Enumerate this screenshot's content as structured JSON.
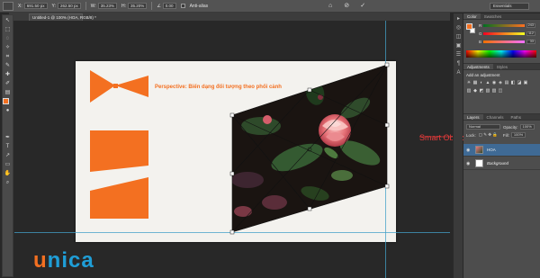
{
  "options_bar": {
    "x_label": "X:",
    "x_value": "691.50 px",
    "y_label": "Y:",
    "y_value": "262.50 px",
    "w_label": "W:",
    "w_value": "35.23%",
    "h_label": "H:",
    "h_value": "35.20%",
    "angle_value": "0.00",
    "antialias_label": "Anti-alias",
    "workspace_value": "Essentials"
  },
  "document": {
    "tab_title": "Untitled-1 @ 100% (HOA, RGB/8) *"
  },
  "canvas": {
    "headline": "Perspective: Biến dạng đối tượng theo phối cảnh",
    "accent_color": "#f37021"
  },
  "annotation": {
    "smart_object_label": "Smart Object"
  },
  "brand": {
    "part1": "u",
    "part2": "nica",
    "color_orange": "#f37021",
    "color_blue": "#1f9ed7"
  },
  "panels": {
    "color_tabs": [
      "Color",
      "Swatches"
    ],
    "rgb": [
      {
        "channel": "R",
        "value": "243"
      },
      {
        "channel": "G",
        "value": "112"
      },
      {
        "channel": "B",
        "value": "33"
      }
    ],
    "adjust_tabs": [
      "Adjustments",
      "Styles"
    ],
    "adjust_title": "Add an adjustment",
    "adjust_icons": [
      "☀",
      "▦",
      "◐",
      "▲",
      "◉",
      "◈",
      "▤",
      "◧",
      "◪",
      "▣",
      "▥",
      "◆",
      "◩",
      "▧",
      "▨",
      "◫"
    ],
    "layers_tabs": [
      "Layers",
      "Channels",
      "Paths"
    ],
    "blend_mode": "Normal",
    "opacity_label": "Opacity:",
    "opacity_value": "100%",
    "lock_label": "Lock:",
    "fill_label": "Fill:",
    "fill_value": "100%",
    "layers": [
      {
        "name": "HOA",
        "active": true
      },
      {
        "name": "Background",
        "active": false
      }
    ]
  },
  "tools": [
    "↖",
    "⬚",
    "◌",
    "✧",
    "⌗",
    "✎",
    "✚",
    "✐",
    "▤",
    "◑",
    "●",
    "✒",
    "T",
    "↗",
    "▭",
    "✋",
    "⌕"
  ],
  "dock_icons": [
    "▸",
    "◎",
    "◫",
    "▣",
    "☰",
    "¶",
    "A"
  ]
}
